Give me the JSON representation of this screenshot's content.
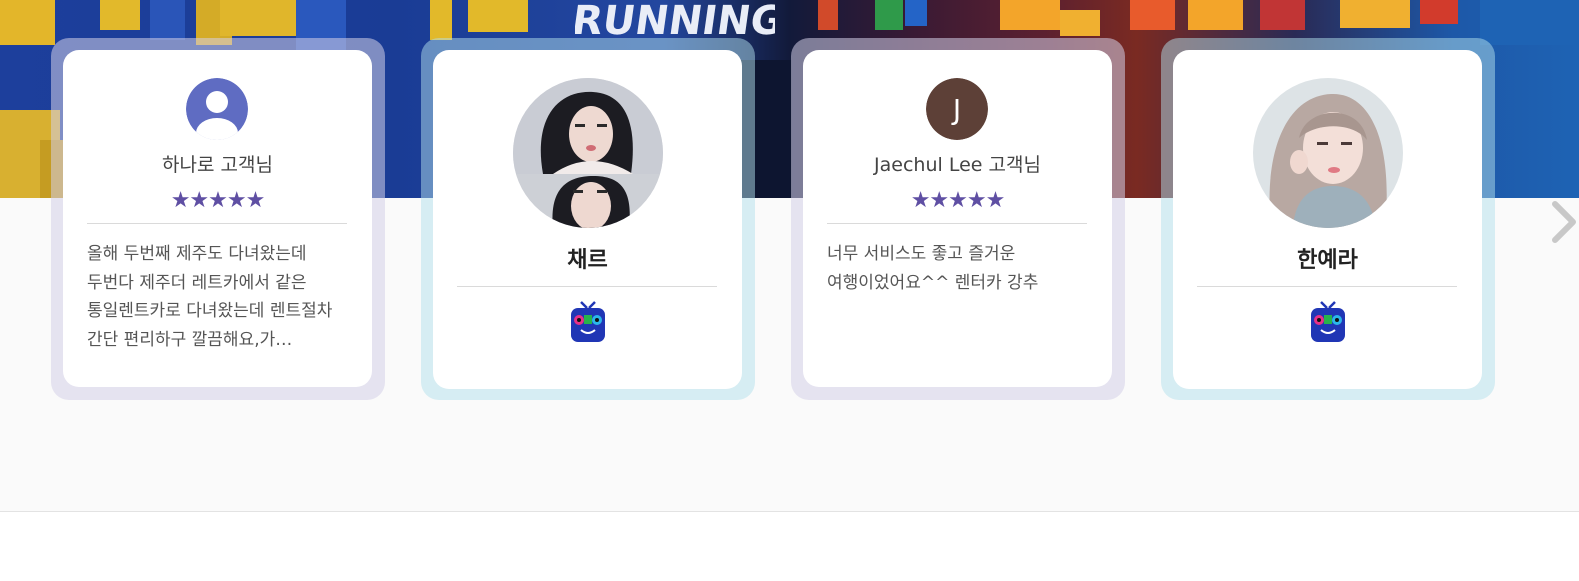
{
  "banner": {
    "text": "RUNNING"
  },
  "reviews": [
    {
      "name": "하나로 고객님",
      "stars": "★★★★★",
      "text": "올해 두번째 제주도 다녀왔는데 두번다 제주더 레트카에서 같은 통일렌트카로 다녀왔는데 렌트절차 간단 편리하구 깔끔해요,가…"
    },
    {
      "name": "채르",
      "source": "tv-character-icon"
    },
    {
      "name": "Jaechul Lee 고객님",
      "initial": "J",
      "stars": "★★★★★",
      "text": "너무 서비스도 좋고 즐거운 여행이었어요^^ 렌터카 강추"
    },
    {
      "name": "한예라",
      "source": "tv-character-icon"
    }
  ],
  "colors": {
    "star": "#5f4fa3",
    "avatar_default": "#5f6cc2",
    "avatar_initial": "#5d4037"
  }
}
